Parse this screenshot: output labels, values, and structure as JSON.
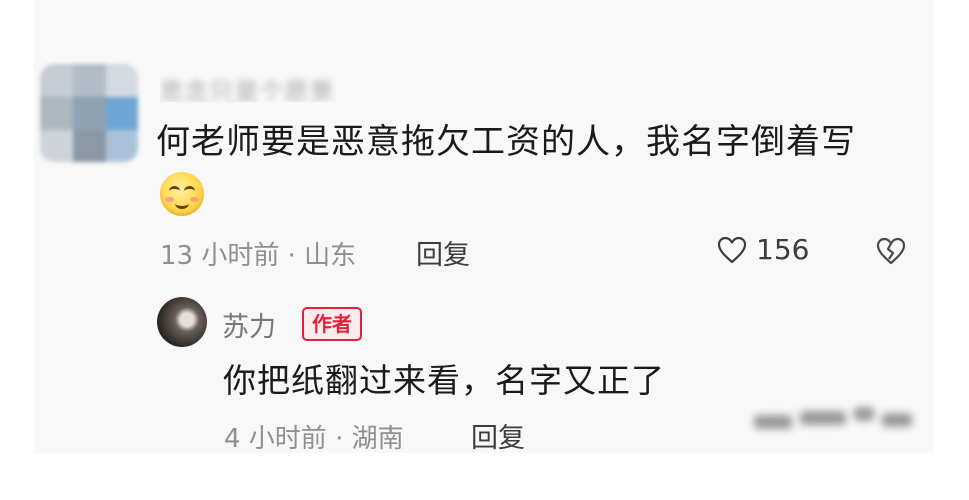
{
  "comment": {
    "username_blurred": "思念只是个愿景",
    "text": "何老师要是恶意拖欠工资的人，我名字倒着写",
    "emoji": "smiling-face-emoji",
    "time": "13 小时前",
    "location": "山东",
    "separator": "·",
    "reply_label": "回复",
    "likes": "156"
  },
  "reply": {
    "author_name": "苏力",
    "author_badge": "作者",
    "text": "你把纸翻过来看，名字又正了",
    "time": "4 小时前",
    "location": "湖南",
    "separator": "·",
    "reply_label": "回复"
  },
  "colors": {
    "panel_bg": "#f8f8f8",
    "badge_red": "#e3203a",
    "meta_gray": "#8f8f8f",
    "text_dark": "#1a1a1a"
  }
}
